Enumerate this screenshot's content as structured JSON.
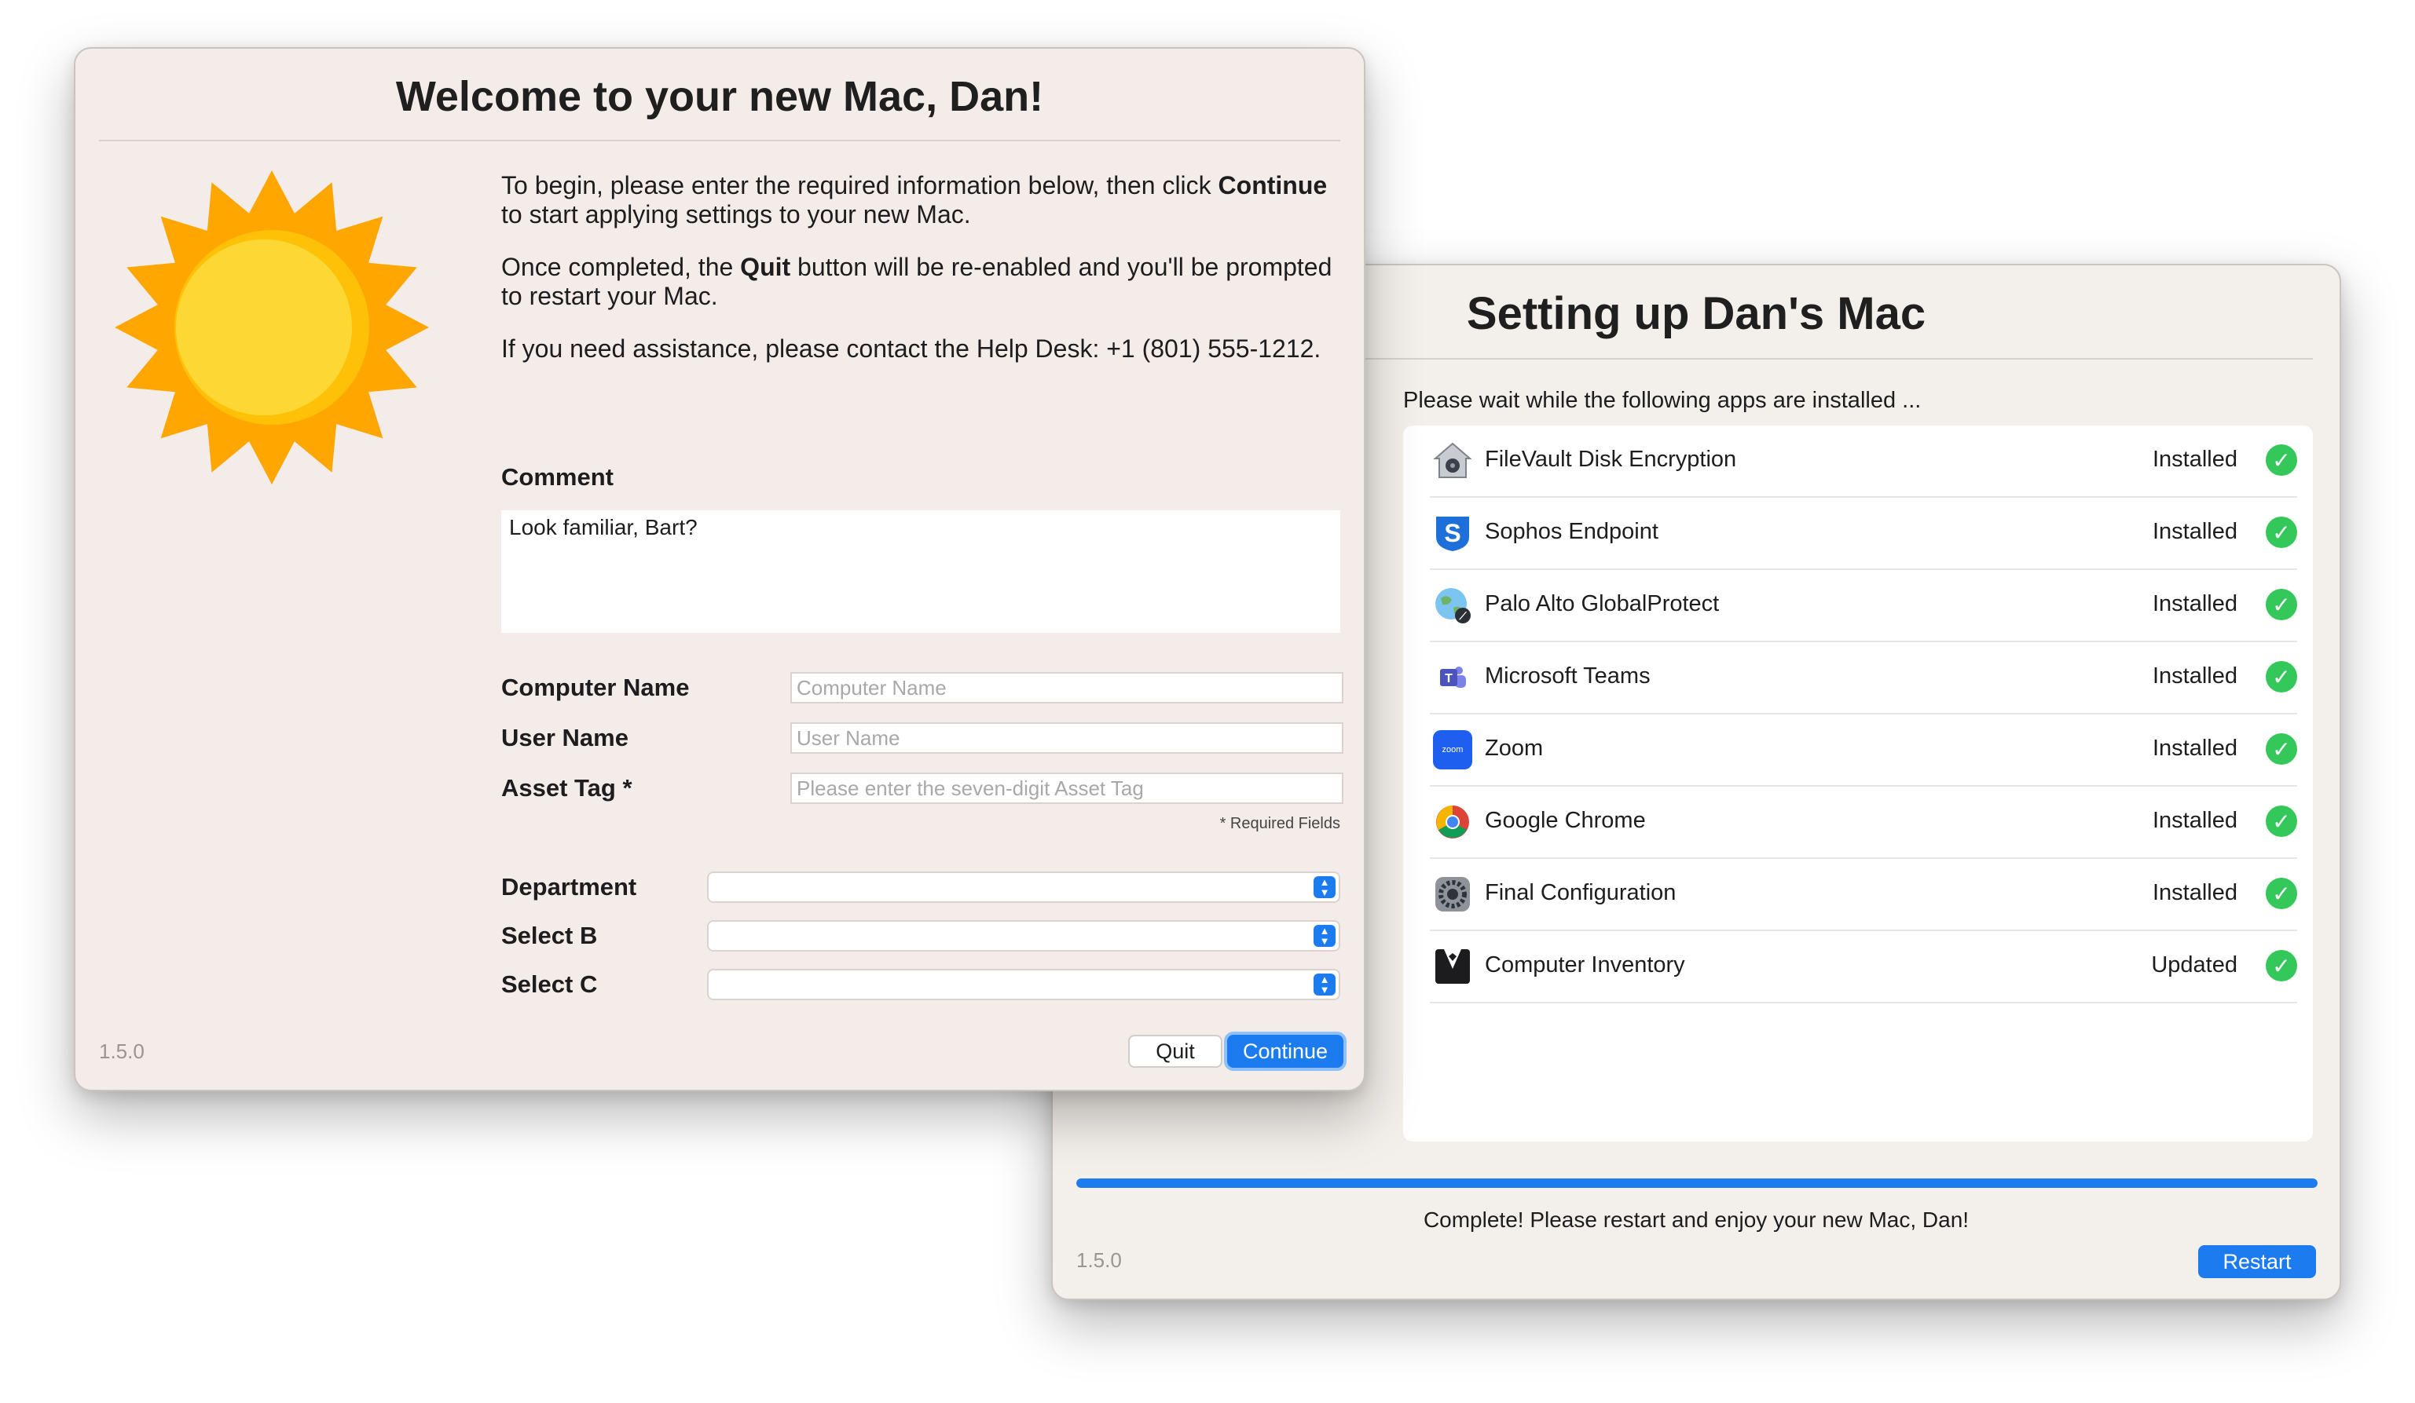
{
  "setup_window": {
    "title": "Setting up Dan's Mac",
    "intro": "Please wait while the following apps are installed ...",
    "apps": [
      {
        "name": "FileVault Disk Encryption",
        "status": "Installed",
        "icon": "filevault-icon"
      },
      {
        "name": "Sophos Endpoint",
        "status": "Installed",
        "icon": "sophos-icon"
      },
      {
        "name": "Palo Alto GlobalProtect",
        "status": "Installed",
        "icon": "globalprotect-icon"
      },
      {
        "name": "Microsoft Teams",
        "status": "Installed",
        "icon": "teams-icon"
      },
      {
        "name": "Zoom",
        "status": "Installed",
        "icon": "zoom-icon"
      },
      {
        "name": "Google Chrome",
        "status": "Installed",
        "icon": "chrome-icon"
      },
      {
        "name": "Final Configuration",
        "status": "Installed",
        "icon": "system-preferences-icon"
      },
      {
        "name": "Computer Inventory",
        "status": "Updated",
        "icon": "tuxedo-icon"
      }
    ],
    "zoom_icon_text": "zoom",
    "progress": 1.0,
    "complete_message": "Complete! Please restart and enjoy your new Mac, Dan!",
    "version": "1.5.0",
    "restart_label": "Restart"
  },
  "welcome_window": {
    "title": "Welcome to your new Mac, Dan!",
    "para1_a": "To begin, please enter the required information below, then click ",
    "para1_bold": "Continue",
    "para1_b": " to start applying settings to your new Mac.",
    "para2_a": "Once completed, the ",
    "para2_bold": "Quit",
    "para2_b": " button will be re-enabled and you'll be prompted to restart your Mac.",
    "para3": "If you need assistance, please contact the Help Desk: +1 (801) 555-1212.",
    "comment_label": "Comment",
    "comment_value": "Look familiar, Bart?",
    "fields": {
      "computer_name_label": "Computer Name",
      "computer_name_placeholder": "Computer Name",
      "user_name_label": "User Name",
      "user_name_placeholder": "User Name",
      "asset_tag_label": "Asset Tag *",
      "asset_tag_placeholder": "Please enter the seven-digit Asset Tag"
    },
    "required_note": "* Required Fields",
    "selects": {
      "department_label": "Department",
      "select_b_label": "Select B",
      "select_c_label": "Select C"
    },
    "version": "1.5.0",
    "quit_label": "Quit",
    "continue_label": "Continue"
  },
  "colors": {
    "accent": "#1d7bf0",
    "success": "#34c759",
    "sun_rays": "#ffa600",
    "sun_core": "#fdd835"
  }
}
